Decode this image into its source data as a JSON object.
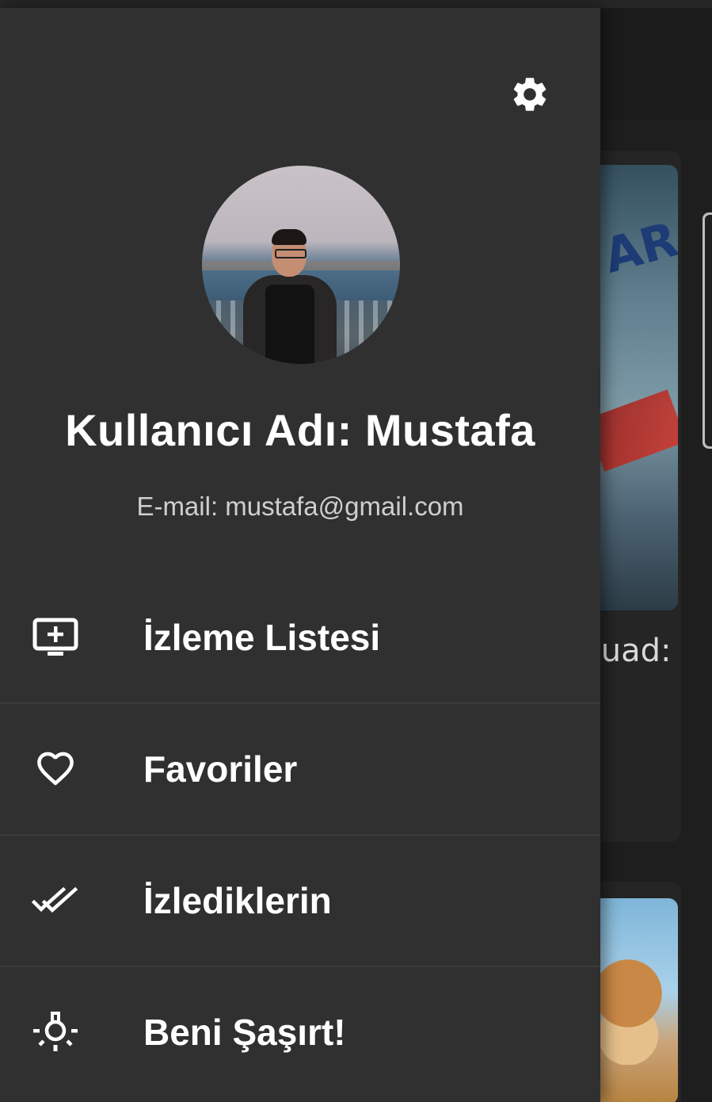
{
  "colors": {
    "drawer_bg": "#303030",
    "text_primary": "#ffffff",
    "text_secondary": "#cfcfcf"
  },
  "drawer": {
    "settings_icon": "gear-icon",
    "profile": {
      "username_line": "Kullanıcı Adı: Mustafa",
      "email_line": "E-mail: mustafa@gmail.com"
    },
    "menu": [
      {
        "icon": "add-to-list-tv-icon",
        "label": "İzleme Listesi"
      },
      {
        "icon": "heart-icon",
        "label": "Favoriler"
      },
      {
        "icon": "double-check-icon",
        "label": "İzlediklerin"
      },
      {
        "icon": "lightbulb-icon",
        "label": "Beni Şaşırt!"
      }
    ]
  },
  "background": {
    "movie_title_partial": "quad:\ni"
  }
}
